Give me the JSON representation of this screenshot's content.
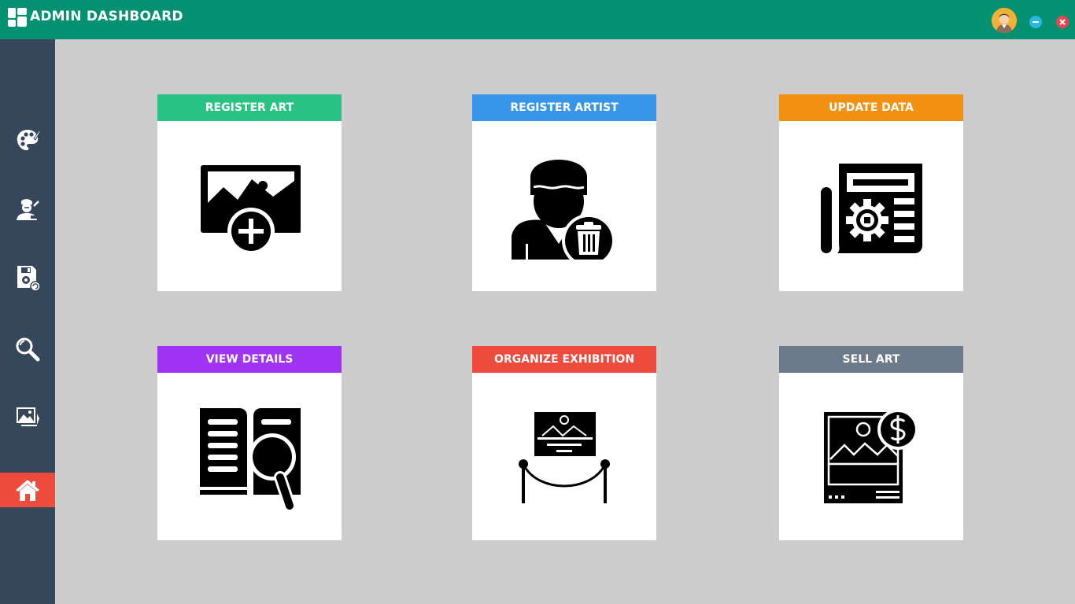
{
  "header": {
    "title": "ADMIN DASHBOARD",
    "logo_icon": "dashboard-grid-icon",
    "avatar_icon": "user-avatar-icon",
    "minimize_icon": "minimize-icon",
    "close_icon": "close-icon"
  },
  "sidebar": {
    "items": [
      {
        "icon": "palette-icon",
        "active": false
      },
      {
        "icon": "artist-painter-icon",
        "active": false
      },
      {
        "icon": "save-settings-icon",
        "active": false
      },
      {
        "icon": "search-icon",
        "active": false
      },
      {
        "icon": "image-gallery-icon",
        "active": false
      },
      {
        "icon": "home-icon",
        "active": true
      }
    ]
  },
  "cards": [
    {
      "label": "REGISTER ART",
      "color": "#28c382",
      "icon": "add-image-icon"
    },
    {
      "label": "REGISTER ARTIST",
      "color": "#3795ea",
      "icon": "artist-delete-icon"
    },
    {
      "label": "UPDATE DATA",
      "color": "#f29111",
      "icon": "newspaper-gear-icon"
    },
    {
      "label": "VIEW DETAILS",
      "color": "#a034f5",
      "icon": "book-search-icon"
    },
    {
      "label": "ORGANIZE EXHIBITION",
      "color": "#ef4b3d",
      "icon": "exhibition-icon"
    },
    {
      "label": "SELL ART",
      "color": "#6c7a8a",
      "icon": "sell-art-icon"
    }
  ],
  "colors": {
    "topbar": "#049172",
    "sidebar": "#35475a",
    "active_nav": "#ef4b3d",
    "background": "#cdcdcd"
  }
}
